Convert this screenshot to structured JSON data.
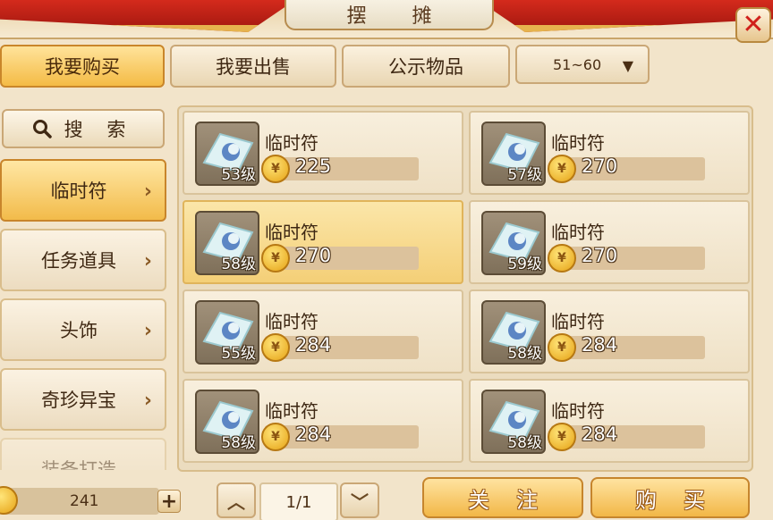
{
  "window": {
    "title": "摆  摊",
    "close_glyph": "✕"
  },
  "tabs": [
    {
      "label": "我要购买",
      "active": true
    },
    {
      "label": "我要出售",
      "active": false
    },
    {
      "label": "公示物品",
      "active": false
    }
  ],
  "level_filter": {
    "value": "51~60",
    "chevron": "▼"
  },
  "sidebar": {
    "search_label": "搜 索",
    "categories": [
      {
        "label": "临时符",
        "active": true
      },
      {
        "label": "任务道具",
        "active": false
      },
      {
        "label": "头饰",
        "active": false
      },
      {
        "label": "奇珍异宝",
        "active": false
      },
      {
        "label": "装备打造",
        "active": false
      }
    ],
    "arrow_glyph": "›"
  },
  "items": [
    {
      "name": "临时符",
      "level": "53级",
      "price": "225",
      "selected": false
    },
    {
      "name": "临时符",
      "level": "57级",
      "price": "270",
      "selected": false
    },
    {
      "name": "临时符",
      "level": "58级",
      "price": "270",
      "selected": true
    },
    {
      "name": "临时符",
      "level": "59级",
      "price": "270",
      "selected": false
    },
    {
      "name": "临时符",
      "level": "55级",
      "price": "284",
      "selected": false
    },
    {
      "name": "临时符",
      "level": "58级",
      "price": "284",
      "selected": false
    },
    {
      "name": "临时符",
      "level": "58级",
      "price": "284",
      "selected": false
    },
    {
      "name": "临时符",
      "level": "58级",
      "price": "284",
      "selected": false
    }
  ],
  "footer": {
    "money": "241",
    "plus_glyph": "+",
    "page": "1/1",
    "page_up_glyph": "︿",
    "page_down_glyph": "﹀",
    "follow_label": "关注",
    "buy_label": "购买"
  },
  "colors": {
    "accent": "#f2b747",
    "close": "#d0201b",
    "roof": "#c8231a"
  },
  "icons": {
    "search": "search-icon",
    "coin": "coin-icon",
    "talisman": "talisman-icon"
  }
}
